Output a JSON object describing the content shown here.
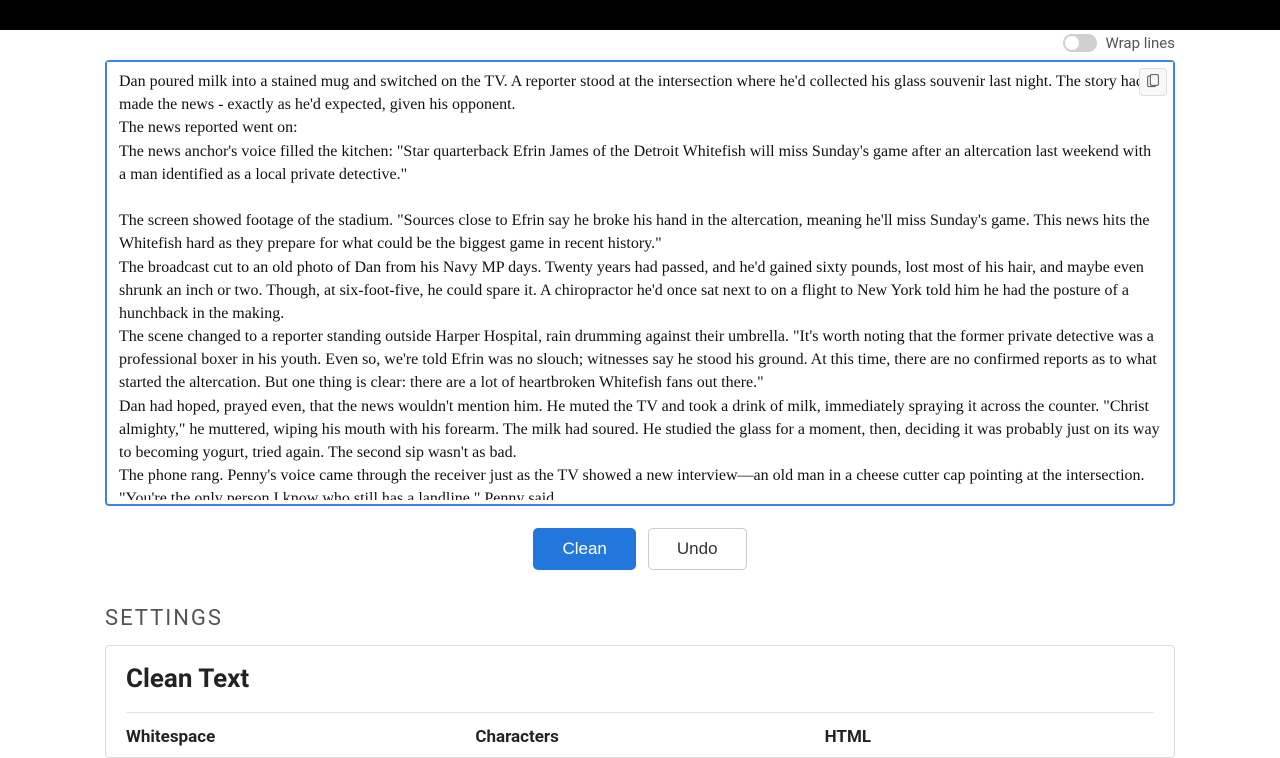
{
  "toolbar": {
    "wrap_label": "Wrap lines"
  },
  "textarea": {
    "value": "Dan poured milk into a stained mug and switched on the TV. A reporter stood at the intersection where he'd collected his glass souvenir last night. The story had made the news - exactly as he'd expected, given his opponent.\nThe news reported went on:\nThe news anchor's voice filled the kitchen: \"Star quarterback Efrin James of the Detroit Whitefish will miss Sunday's game after an altercation last weekend with a man identified as a local private detective.\"\n\nThe screen showed footage of the stadium. \"Sources close to Efrin say he broke his hand in the altercation, meaning he'll miss Sunday's game. This news hits the Whitefish hard as they prepare for what could be the biggest game in recent history.\"\nThe broadcast cut to an old photo of Dan from his Navy MP days. Twenty years had passed, and he'd gained sixty pounds, lost most of his hair, and maybe even shrunk an inch or two. Though, at six-foot-five, he could spare it. A chiropractor he'd once sat next to on a flight to New York told him he had the posture of a hunchback in the making.\nThe scene changed to a reporter standing outside Harper Hospital, rain drumming against their umbrella. \"It's worth noting that the former private detective was a professional boxer in his youth. Even so, we're told Efrin was no slouch; witnesses say he stood his ground. At this time, there are no confirmed reports as to what started the altercation. But one thing is clear: there are a lot of heartbroken Whitefish fans out there.\"\nDan had hoped, prayed even, that the news wouldn't mention him. He muted the TV and took a drink of milk, immediately spraying it across the counter. \"Christ almighty,\" he muttered, wiping his mouth with his forearm. The milk had soured. He studied the glass for a moment, then, deciding it was probably just on its way to becoming yogurt, tried again. The second sip wasn't as bad.\nThe phone rang. Penny's voice came through the receiver just as the TV showed a new interview—an old man in a cheese cutter cap pointing at the intersection.\n\"You're the only person I know who still has a landline,\" Penny said.\n\"I worked on a case for a lineman,\" Dan explained, forcing down another drink of the milk. It made him wince, but he took one more before setting it down. \"He"
  },
  "buttons": {
    "clean": "Clean",
    "undo": "Undo"
  },
  "settings": {
    "heading": "Settings",
    "panel_title": "Clean Text",
    "columns": {
      "whitespace": "Whitespace",
      "characters": "Characters",
      "html": "HTML"
    }
  }
}
